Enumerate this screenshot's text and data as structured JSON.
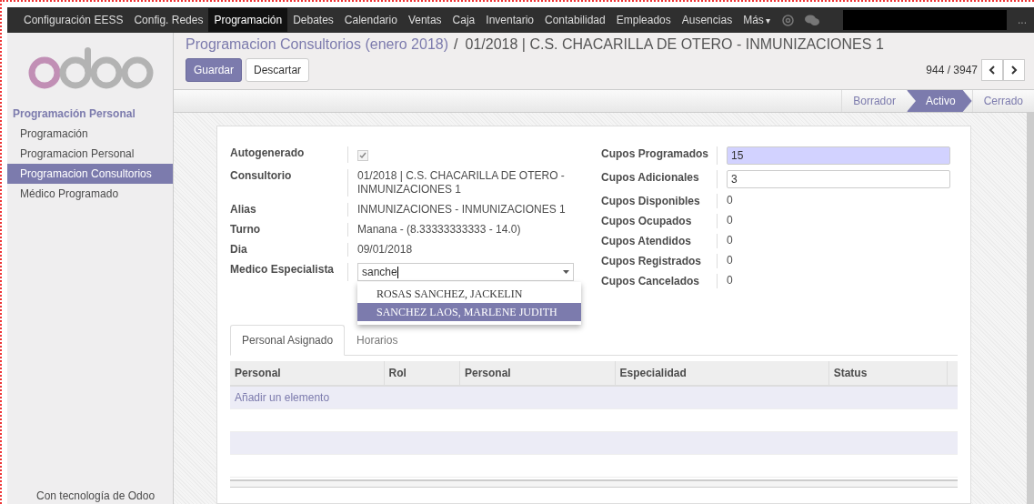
{
  "top_menu": [
    {
      "label": "Configuración EESS",
      "selected": false
    },
    {
      "label": "Config. Redes",
      "selected": false
    },
    {
      "label": "Programación",
      "selected": true
    },
    {
      "label": "Debates",
      "selected": false
    },
    {
      "label": "Calendario",
      "selected": false
    },
    {
      "label": "Ventas",
      "selected": false
    },
    {
      "label": "Caja",
      "selected": false
    },
    {
      "label": "Inventario",
      "selected": false
    },
    {
      "label": "Contabilidad",
      "selected": false
    },
    {
      "label": "Empleados",
      "selected": false
    },
    {
      "label": "Ausencias",
      "selected": false
    },
    {
      "label": "Más",
      "selected": false,
      "caret": "▾"
    }
  ],
  "top_right": {
    "more": "..."
  },
  "sidebar": {
    "section": "Programación Personal",
    "items": [
      {
        "label": "Programación",
        "selected": false
      },
      {
        "label": "Programacion Personal",
        "selected": false
      },
      {
        "label": "Programacion Consultorios",
        "selected": true
      },
      {
        "label": "Médico Programado",
        "selected": false
      }
    ],
    "footer": "Con tecnología de Odoo"
  },
  "breadcrumb": {
    "parent": "Programacion Consultorios (enero 2018)",
    "separator": "/",
    "current": "01/2018 | C.S. CHACARILLA DE OTERO - INMUNIZACIONES 1"
  },
  "buttons": {
    "save": "Guardar",
    "discard": "Descartar"
  },
  "pager": "944 / 3947",
  "status_steps": [
    {
      "label": "Borrador",
      "selected": false
    },
    {
      "label": "Activo",
      "selected": true
    },
    {
      "label": "Cerrado",
      "selected": false
    }
  ],
  "left_fields": [
    {
      "label": "Autogenerado",
      "kind": "checkbox",
      "checked": true
    },
    {
      "label": "Consultorio",
      "kind": "text",
      "value": "01/2018 | C.S. CHACARILLA DE OTERO - INMUNIZACIONES 1"
    },
    {
      "label": "Alias",
      "kind": "text",
      "value": "INMUNIZACIONES - INMUNIZACIONES 1"
    },
    {
      "label": "Turno",
      "kind": "text",
      "value": "Manana - (8.33333333333 - 14.0)"
    },
    {
      "label": "Dia",
      "kind": "text",
      "value": "09/01/2018"
    },
    {
      "label": "Medico Especialista",
      "kind": "combo",
      "value": "sanche"
    }
  ],
  "dropdown": [
    {
      "label": "ROSAS SANCHEZ, JACKELIN",
      "selected": false
    },
    {
      "label": "SANCHEZ LAOS, MARLENE JUDITH",
      "selected": true
    }
  ],
  "right_fields": [
    {
      "label": "Cupos Programados",
      "kind": "input",
      "required": true,
      "value": "15"
    },
    {
      "label": "Cupos Adicionales",
      "kind": "input",
      "required": false,
      "value": "3"
    },
    {
      "label": "Cupos Disponibles",
      "kind": "text",
      "value": "0"
    },
    {
      "label": "Cupos Ocupados",
      "kind": "text",
      "value": "0"
    },
    {
      "label": "Cupos Atendidos",
      "kind": "text",
      "value": "0"
    },
    {
      "label": "Cupos Registrados",
      "kind": "text",
      "value": "0"
    },
    {
      "label": "Cupos Cancelados",
      "kind": "text",
      "value": "0"
    }
  ],
  "tabs": [
    {
      "label": "Personal Asignado",
      "selected": true
    },
    {
      "label": "Horarios",
      "selected": false
    }
  ],
  "table": {
    "columns": [
      "Personal",
      "Rol",
      "Personal",
      "Especialidad",
      "Status"
    ],
    "add_link": "Añadir un elemento"
  }
}
